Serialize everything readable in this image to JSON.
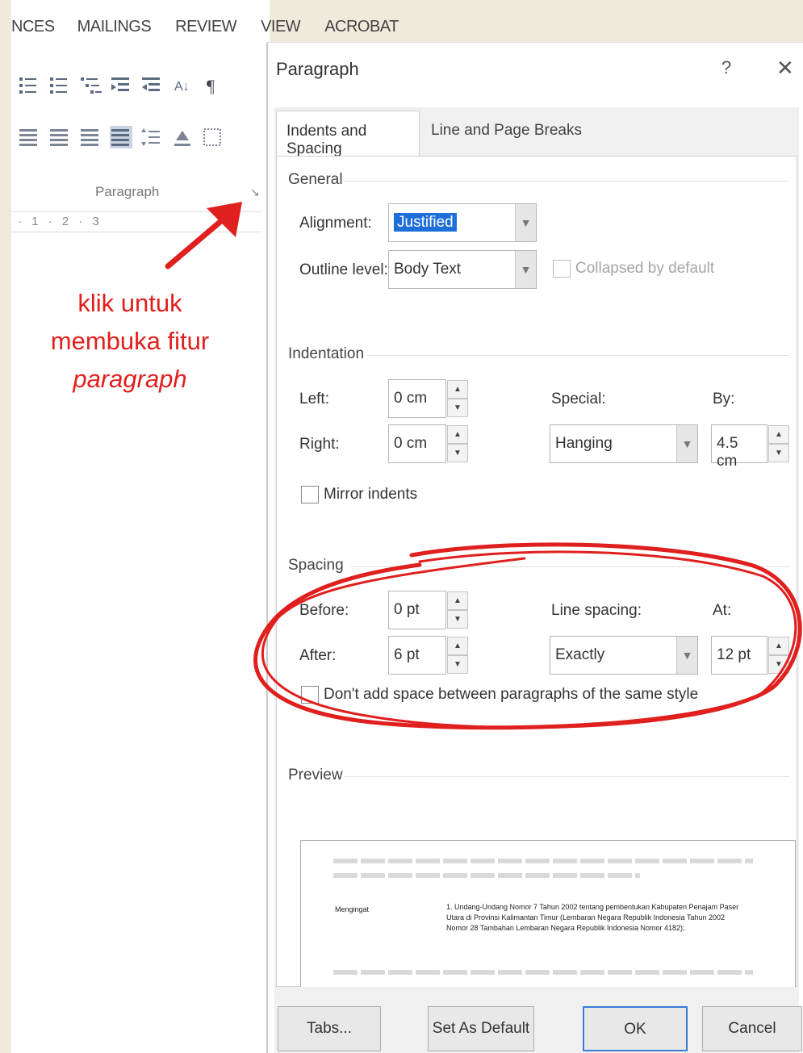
{
  "ribbon": {
    "tabs": [
      "NCES",
      "MAILINGS",
      "REVIEW",
      "VIEW",
      "ACROBAT"
    ],
    "group_label": "Paragraph",
    "launcher_glyph": "↘",
    "ruler_text": "· 1 · 2 · 3"
  },
  "annotation": {
    "line1": "klik untuk",
    "line2": "membuka fitur",
    "line3": "paragraph",
    "color": "#e0201e"
  },
  "dialog": {
    "title": "Paragraph",
    "help": "?",
    "close": "✕",
    "tabs": {
      "indents_spacing": "Indents and Spacing",
      "line_page_breaks": "Line and Page Breaks"
    },
    "general": {
      "heading": "General",
      "alignment_label": "Alignment:",
      "alignment_value": "Justified",
      "outline_label": "Outline level:",
      "outline_value": "Body Text",
      "collapsed_label": "Collapsed by default"
    },
    "indentation": {
      "heading": "Indentation",
      "left_label": "Left:",
      "left_value": "0 cm",
      "right_label": "Right:",
      "right_value": "0 cm",
      "special_label": "Special:",
      "special_value": "Hanging",
      "by_label": "By:",
      "by_value": "4.5 cm",
      "mirror_label": "Mirror indents"
    },
    "spacing": {
      "heading": "Spacing",
      "before_label": "Before:",
      "before_value": "0 pt",
      "after_label": "After:",
      "after_value": "6 pt",
      "line_spacing_label": "Line spacing:",
      "line_spacing_value": "Exactly",
      "at_label": "At:",
      "at_value": "12 pt",
      "dont_add_label": "Don't add space between paragraphs of the same style"
    },
    "preview": {
      "heading": "Preview",
      "key": "Mengingat",
      "body": "1.    Undang-Undang Nomor 7 Tahun 2002 tentang pembentukan Kabupaten Penajam Paser Utara di Provinsi Kalimantan Timur (Lembaran Negara Republik Indonesia Tahun 2002 Nomor 28 Tambahan Lembaran Negara Republik Indonesia Nomor 4182);"
    },
    "buttons": {
      "tabs": "Tabs...",
      "set_default": "Set As Default",
      "ok": "OK",
      "cancel": "Cancel"
    }
  },
  "colors": {
    "highlight": "#1e6fd9",
    "annotation_red": "#e0201e"
  }
}
